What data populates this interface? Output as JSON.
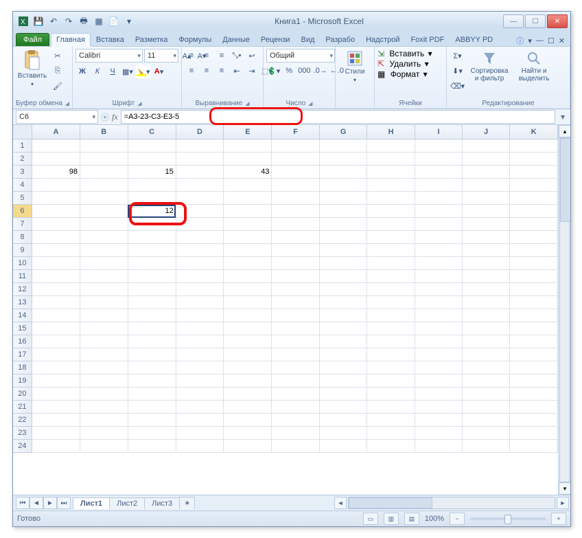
{
  "title": "Книга1  -  Microsoft Excel",
  "qat": [
    "excel",
    "save",
    "undo",
    "redo",
    "print",
    "new",
    "open"
  ],
  "tabs": {
    "file": "Файл",
    "items": [
      "Главная",
      "Вставка",
      "Разметка",
      "Формулы",
      "Данные",
      "Рецензи",
      "Вид",
      "Разрабо",
      "Надстрой",
      "Foxit PDF",
      "ABBYY PD"
    ],
    "active_index": 0
  },
  "ribbon": {
    "clipboard": {
      "paste": "Вставить",
      "label": "Буфер обмена"
    },
    "font": {
      "name": "Calibri",
      "size": "11",
      "label": "Шрифт",
      "bold": "Ж",
      "italic": "К",
      "underline": "Ч"
    },
    "align": {
      "label": "Выравнивание"
    },
    "number": {
      "format": "Общий",
      "label": "Число"
    },
    "styles": {
      "label": "Стили",
      "btn": "Стили"
    },
    "cells": {
      "insert": "Вставить",
      "delete": "Удалить",
      "format": "Формат",
      "label": "Ячейки"
    },
    "editing": {
      "sort": "Сортировка и фильтр",
      "find": "Найти и выделить",
      "label": "Редактирование"
    }
  },
  "formula_bar": {
    "cell_ref": "C6",
    "fx": "fx",
    "formula": "=A3-23-C3-E3-5"
  },
  "columns": [
    "A",
    "B",
    "C",
    "D",
    "E",
    "F",
    "G",
    "H",
    "I",
    "J",
    "K"
  ],
  "rows": 24,
  "cells": {
    "A3": "98",
    "C3": "15",
    "E3": "43",
    "C6": "12"
  },
  "active_cell": "C6",
  "sheets": {
    "items": [
      "Лист1",
      "Лист2",
      "Лист3"
    ],
    "active": 0
  },
  "status": {
    "ready": "Готово",
    "zoom": "100%"
  }
}
